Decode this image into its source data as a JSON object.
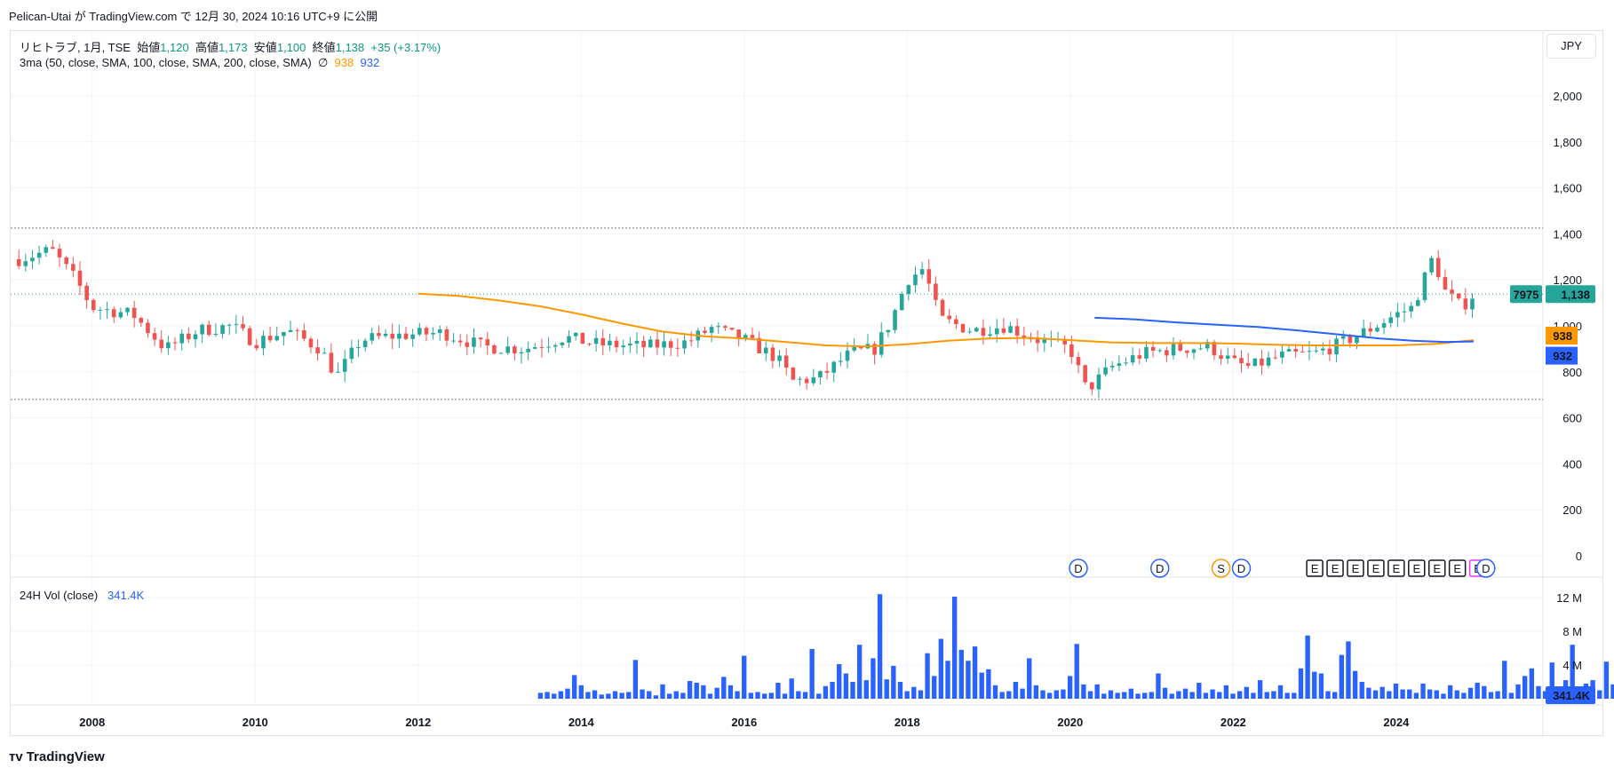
{
  "header": {
    "published_by": "Pelican-Utai が TradingView.com で 12月 30, 2024 10:16 UTC+9 に公開"
  },
  "legend": {
    "symbol": "リヒトラブ, 1月, TSE",
    "open_label": "始値",
    "open": "1,120",
    "high_label": "高値",
    "high": "1,173",
    "low_label": "安値",
    "low": "1,100",
    "close_label": "終値",
    "close": "1,138",
    "change": "+35 (+3.17%)",
    "ma_label": "3ma (50, close, SMA, 100, close, SMA, 200, close, SMA)",
    "ma_empty": "∅",
    "ma1_value": "938",
    "ma2_value": "932",
    "vol_label": "24H Vol (close)",
    "vol_value": "341.4K"
  },
  "currency": "JPY",
  "footer": {
    "brand": "TradingView"
  },
  "chart_data": [
    {
      "type": "candlestick",
      "interval": "1M",
      "y_ticks": [
        0,
        200,
        400,
        600,
        800,
        1000,
        1200,
        1400,
        1600,
        1800,
        2000
      ],
      "y_tick_labels": [
        "0",
        "200",
        "400",
        "600",
        "800",
        "1,000",
        "1,200",
        "1,400",
        "1,600",
        "1,800",
        "2,000"
      ],
      "ylim": [
        -50,
        2100
      ],
      "x_ticks": [
        2008,
        2010,
        2012,
        2014,
        2016,
        2018,
        2020,
        2022,
        2024
      ],
      "xlim": [
        2007.0,
        2025.8
      ],
      "hlines": [
        1425,
        680
      ],
      "last_price": 1138,
      "last_price_label": "1,138",
      "symbol_tag": "7975",
      "colors": {
        "up": "#26a69a",
        "down": "#ef5350",
        "ma1": "#ff9800",
        "ma2": "#2962ff"
      },
      "keyframes": [
        [
          2007.1,
          1290
        ],
        [
          2007.5,
          1330
        ],
        [
          2007.8,
          1200
        ],
        [
          2008.0,
          1080
        ],
        [
          2008.5,
          1050
        ],
        [
          2008.9,
          900
        ],
        [
          2009.3,
          980
        ],
        [
          2009.7,
          1000
        ],
        [
          2010.0,
          930
        ],
        [
          2010.4,
          980
        ],
        [
          2010.8,
          900
        ],
        [
          2011.0,
          780
        ],
        [
          2011.3,
          940
        ],
        [
          2011.8,
          960
        ],
        [
          2012.3,
          970
        ],
        [
          2012.8,
          910
        ],
        [
          2013.3,
          900
        ],
        [
          2013.8,
          950
        ],
        [
          2014.2,
          920
        ],
        [
          2014.8,
          910
        ],
        [
          2015.3,
          930
        ],
        [
          2015.6,
          990
        ],
        [
          2016.0,
          940
        ],
        [
          2016.4,
          860
        ],
        [
          2016.6,
          760
        ],
        [
          2016.9,
          770
        ],
        [
          2017.3,
          880
        ],
        [
          2017.6,
          900
        ],
        [
          2017.8,
          1020
        ],
        [
          2018.0,
          1200
        ],
        [
          2018.2,
          1250
        ],
        [
          2018.4,
          1030
        ],
        [
          2018.8,
          980
        ],
        [
          2019.2,
          1000
        ],
        [
          2019.6,
          940
        ],
        [
          2020.0,
          900
        ],
        [
          2020.2,
          720
        ],
        [
          2020.5,
          820
        ],
        [
          2020.9,
          880
        ],
        [
          2021.3,
          900
        ],
        [
          2021.7,
          910
        ],
        [
          2022.0,
          840
        ],
        [
          2022.2,
          820
        ],
        [
          2022.6,
          870
        ],
        [
          2023.0,
          880
        ],
        [
          2023.3,
          920
        ],
        [
          2023.7,
          990
        ],
        [
          2024.0,
          1050
        ],
        [
          2024.2,
          1080
        ],
        [
          2024.45,
          1300
        ],
        [
          2024.6,
          1150
        ],
        [
          2024.8,
          1080
        ],
        [
          2024.95,
          1138
        ]
      ],
      "ma1": [
        [
          2012.0,
          1140
        ],
        [
          2012.5,
          1130
        ],
        [
          2013.0,
          1110
        ],
        [
          2013.5,
          1085
        ],
        [
          2014.0,
          1050
        ],
        [
          2014.5,
          1010
        ],
        [
          2015.0,
          975
        ],
        [
          2015.5,
          955
        ],
        [
          2016.0,
          945
        ],
        [
          2016.5,
          930
        ],
        [
          2017.0,
          915
        ],
        [
          2017.5,
          910
        ],
        [
          2018.0,
          920
        ],
        [
          2018.5,
          935
        ],
        [
          2019.0,
          945
        ],
        [
          2019.5,
          948
        ],
        [
          2020.0,
          938
        ],
        [
          2020.5,
          928
        ],
        [
          2021.0,
          925
        ],
        [
          2021.5,
          925
        ],
        [
          2022.0,
          923
        ],
        [
          2022.5,
          918
        ],
        [
          2023.0,
          915
        ],
        [
          2023.5,
          915
        ],
        [
          2024.0,
          915
        ],
        [
          2024.5,
          922
        ],
        [
          2024.95,
          938
        ]
      ],
      "ma2": [
        [
          2020.3,
          1035
        ],
        [
          2020.8,
          1028
        ],
        [
          2021.3,
          1015
        ],
        [
          2021.8,
          1005
        ],
        [
          2022.3,
          995
        ],
        [
          2022.8,
          980
        ],
        [
          2023.3,
          962
        ],
        [
          2023.8,
          945
        ],
        [
          2024.2,
          935
        ],
        [
          2024.6,
          930
        ],
        [
          2024.95,
          932
        ]
      ],
      "events": [
        {
          "x": 2020.1,
          "label": "D",
          "color": "#2962ff"
        },
        {
          "x": 2021.1,
          "label": "D",
          "color": "#2962ff"
        },
        {
          "x": 2021.85,
          "label": "S",
          "color": "#ff9800"
        },
        {
          "x": 2022.1,
          "label": "D",
          "color": "#2962ff"
        },
        {
          "x": 2023.0,
          "label": "E",
          "color": "#131722"
        },
        {
          "x": 2023.25,
          "label": "E",
          "color": "#131722"
        },
        {
          "x": 2023.5,
          "label": "E",
          "color": "#131722"
        },
        {
          "x": 2023.75,
          "label": "E",
          "color": "#131722"
        },
        {
          "x": 2024.0,
          "label": "E",
          "color": "#131722"
        },
        {
          "x": 2024.25,
          "label": "E",
          "color": "#131722"
        },
        {
          "x": 2024.5,
          "label": "E",
          "color": "#131722"
        },
        {
          "x": 2024.75,
          "label": "E",
          "color": "#131722"
        },
        {
          "x": 2025.0,
          "label": "E",
          "color": "#e040fb"
        },
        {
          "x": 2025.1,
          "label": "D",
          "color": "#2962ff"
        }
      ]
    },
    {
      "type": "bar",
      "name": "24H Vol (close)",
      "y_ticks": [
        4,
        8,
        12
      ],
      "y_tick_labels": [
        "4 M",
        "8 M",
        "12 M"
      ],
      "ylim": [
        0,
        13
      ],
      "last_value_label": "341.4K",
      "color": "#2962ff",
      "x_start": 2013.5,
      "x_step": 0.0833,
      "values": [
        0.7,
        0.8,
        0.6,
        0.9,
        1.2,
        2.8,
        1.6,
        0.8,
        1.0,
        0.5,
        0.6,
        0.9,
        0.7,
        0.8,
        4.6,
        1.1,
        0.9,
        0.4,
        1.7,
        0.6,
        0.9,
        0.7,
        2.1,
        1.9,
        1.6,
        0.6,
        1.3,
        2.6,
        1.6,
        0.9,
        5.1,
        0.7,
        0.8,
        0.6,
        0.7,
        1.9,
        0.6,
        2.4,
        0.9,
        0.8,
        5.9,
        0.6,
        1.5,
        2.0,
        4.1,
        3.0,
        2.0,
        6.4,
        2.2,
        4.8,
        12.4,
        2.3,
        3.9,
        2.0,
        0.9,
        1.4,
        1.0,
        5.4,
        2.7,
        7.1,
        4.5,
        12.1,
        5.8,
        4.5,
        6.2,
        3.1,
        3.5,
        1.6,
        0.8,
        0.9,
        2.0,
        1.2,
        4.8,
        1.6,
        1.0,
        0.7,
        1.0,
        1.1,
        2.7,
        6.5,
        1.7,
        0.9,
        1.7,
        0.6,
        1.0,
        0.7,
        0.8,
        1.2,
        0.6,
        0.7,
        0.8,
        3.0,
        1.3,
        0.6,
        0.9,
        1.2,
        0.8,
        1.9,
        0.7,
        1.1,
        0.8,
        1.6,
        0.6,
        0.9,
        1.4,
        0.7,
        2.2,
        0.8,
        0.9,
        1.6,
        0.7,
        0.7,
        3.6,
        7.5,
        3.2,
        3.0,
        0.9,
        0.8,
        5.2,
        6.8,
        3.3,
        2.0,
        1.3,
        1.0,
        1.4,
        0.9,
        1.8,
        1.1,
        1.1,
        0.7,
        1.8,
        1.1,
        1.0,
        0.6,
        1.6,
        1.0,
        0.7,
        1.3,
        1.9,
        1.5,
        0.8,
        0.9,
        4.5,
        0.7,
        1.7,
        2.7,
        3.6,
        1.5,
        0.9,
        4.3,
        1.4,
        2.2,
        6.4,
        1.3,
        1.8,
        2.2,
        1.0,
        4.4,
        1.7,
        2.3,
        3.5,
        2.4,
        3.4,
        0.3
      ]
    }
  ]
}
